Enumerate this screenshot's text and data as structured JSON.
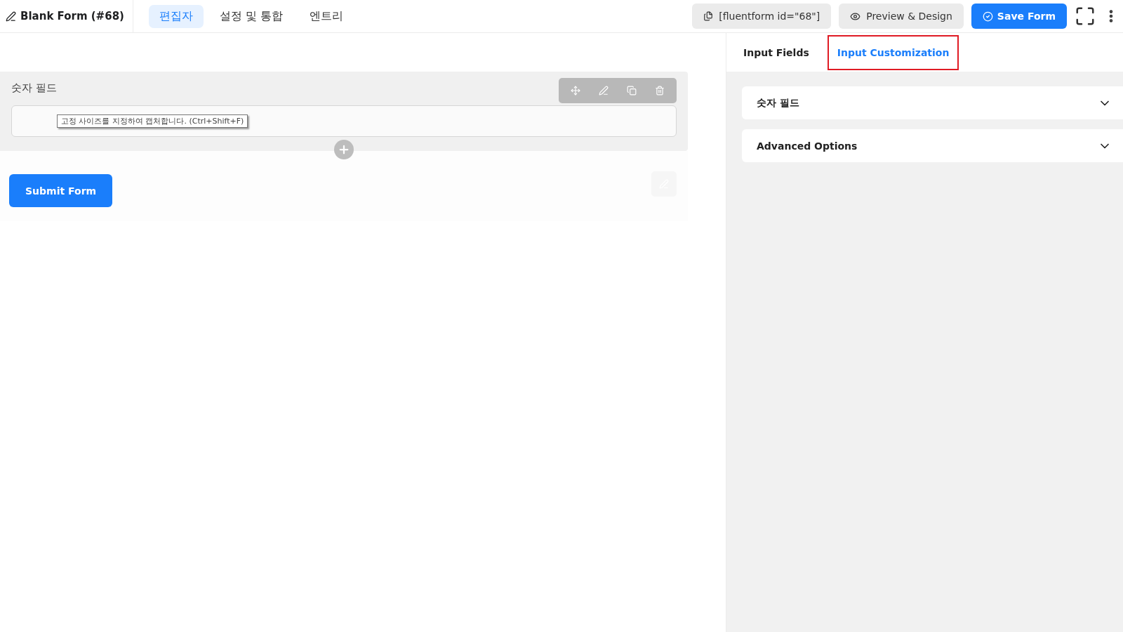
{
  "header": {
    "form_title": "Blank Form (#68)",
    "tabs": [
      {
        "label": "편집자",
        "selected": true
      },
      {
        "label": "설정 및 통합",
        "selected": false
      },
      {
        "label": "엔트리",
        "selected": false
      }
    ],
    "shortcode": "[fluentform id=\"68\"]",
    "preview_button": "Preview & Design",
    "save_button": "Save Form"
  },
  "editor": {
    "field": {
      "label": "숫자 필드",
      "tooltip": "고정 사이즈를 지정하여 캡처합니다. (Ctrl+Shift+F)"
    },
    "submit_button": "Submit Form"
  },
  "sidebar": {
    "tabs": [
      {
        "label": "Input Fields",
        "selected": false
      },
      {
        "label": "Input Customization",
        "selected": true
      }
    ],
    "sections": [
      {
        "title": "숫자 필드",
        "expanded": false
      },
      {
        "title": "Advanced Options",
        "expanded": false
      }
    ]
  }
}
